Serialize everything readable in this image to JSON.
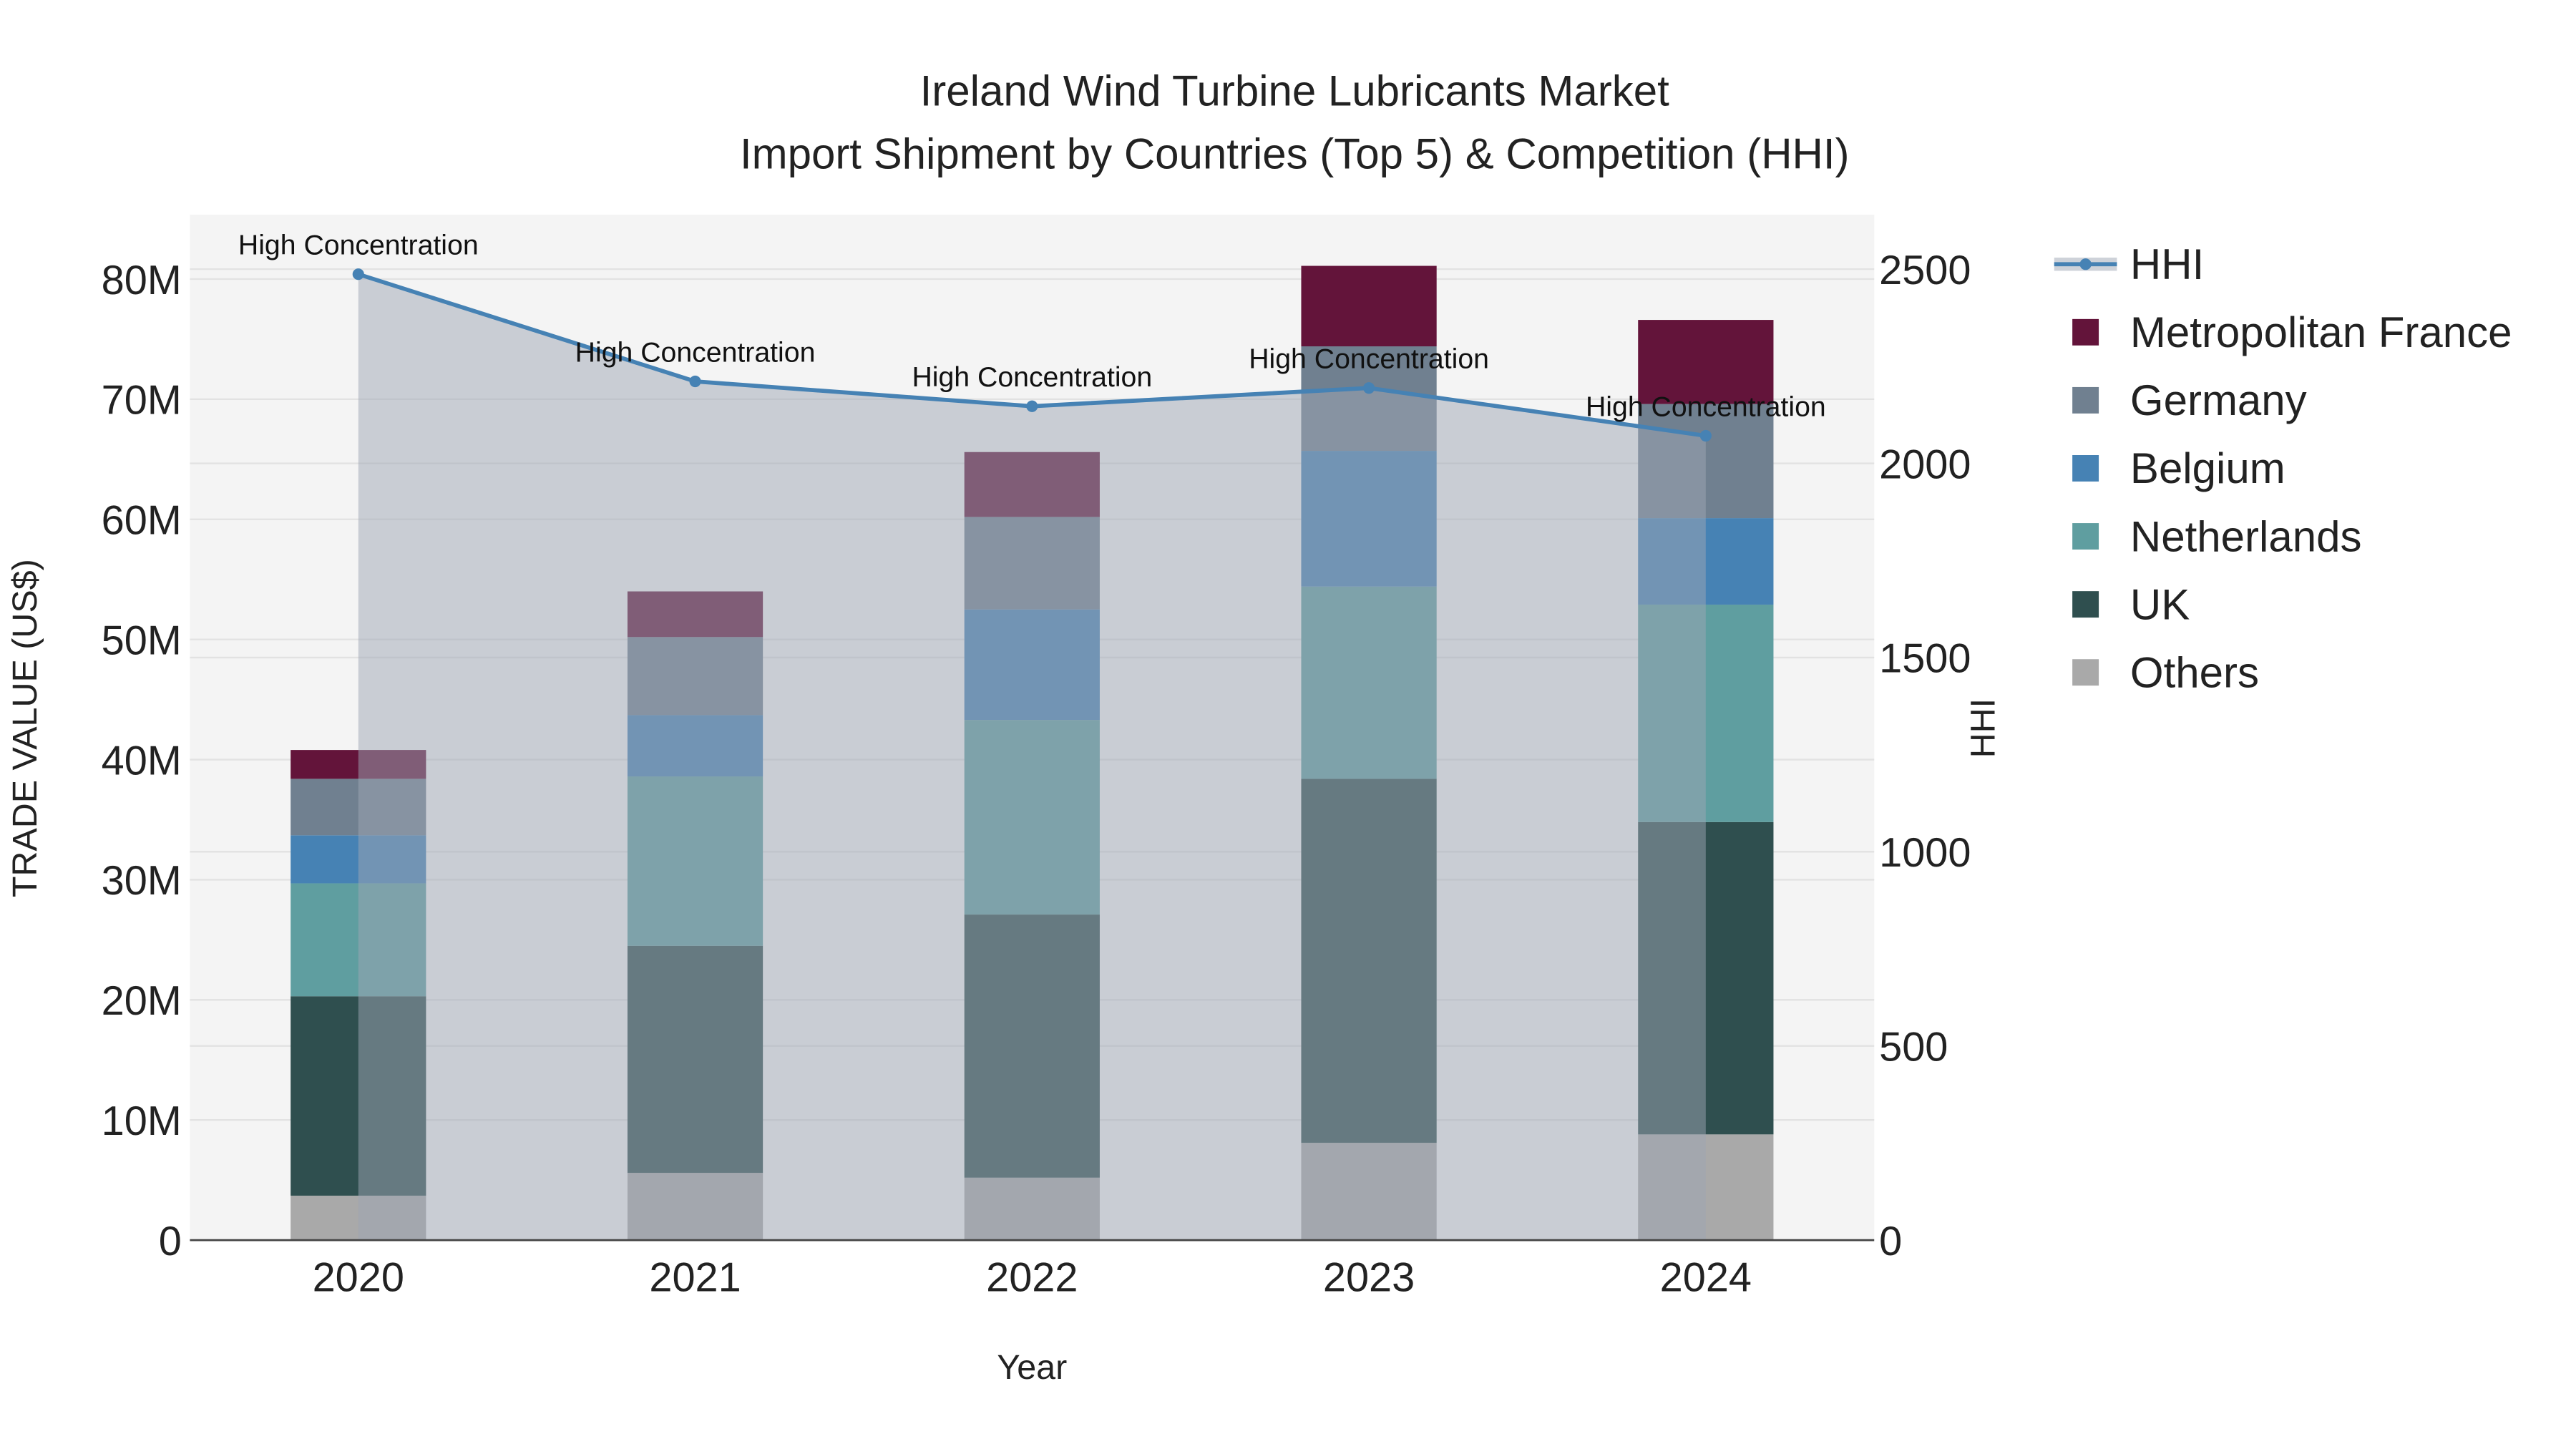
{
  "chart_data": {
    "type": "bar",
    "title": "Ireland Wind Turbine Lubricants Market",
    "subtitle": "Import Shipment by Countries (Top 5) & Competition (HHI)",
    "xlabel": "Year",
    "ylabel": "TRADE VALUE (US$)",
    "y2label": "HHI",
    "ylim": [
      0,
      85000000
    ],
    "y2lim": [
      0,
      2635
    ],
    "yticks": [
      0,
      10000000,
      20000000,
      30000000,
      40000000,
      50000000,
      60000000,
      70000000,
      80000000
    ],
    "ytick_labels": [
      "0",
      "10M",
      "20M",
      "30M",
      "40M",
      "50M",
      "60M",
      "70M",
      "80M"
    ],
    "y2ticks": [
      0,
      500,
      1000,
      1500,
      2000,
      2500
    ],
    "y2tick_labels": [
      "0",
      "500",
      "1000",
      "1500",
      "2000",
      "2500"
    ],
    "categories": [
      "2020",
      "2021",
      "2022",
      "2023",
      "2024"
    ],
    "stacked": true,
    "series": [
      {
        "name": "Others",
        "color": "#a9a9a9",
        "values": [
          3700000,
          5600000,
          5200000,
          8100000,
          8800000
        ]
      },
      {
        "name": "UK",
        "color": "#2f4f4f",
        "values": [
          16600000,
          18900000,
          21900000,
          30300000,
          26000000
        ]
      },
      {
        "name": "Netherlands",
        "color": "#5f9ea0",
        "values": [
          9400000,
          14100000,
          16200000,
          16000000,
          18100000
        ]
      },
      {
        "name": "Belgium",
        "color": "#4682b4",
        "values": [
          4000000,
          5100000,
          9200000,
          11300000,
          7200000
        ]
      },
      {
        "name": "Germany",
        "color": "#708090",
        "values": [
          4700000,
          6500000,
          7700000,
          8700000,
          9500000
        ]
      },
      {
        "name": "Metropolitan France",
        "color": "#63143a",
        "values": [
          2400000,
          3800000,
          5400000,
          6700000,
          7000000
        ]
      }
    ],
    "line": {
      "name": "HHI",
      "color": "#4682b4",
      "values": [
        2487,
        2211,
        2147,
        2194,
        2071
      ]
    },
    "annotations": [
      "High Concentration",
      "High Concentration",
      "High Concentration",
      "High Concentration",
      "High Concentration"
    ],
    "legend_order": [
      "HHI",
      "Metropolitan France",
      "Germany",
      "Belgium",
      "Netherlands",
      "UK",
      "Others"
    ],
    "legend_position": "right",
    "grid": true
  }
}
